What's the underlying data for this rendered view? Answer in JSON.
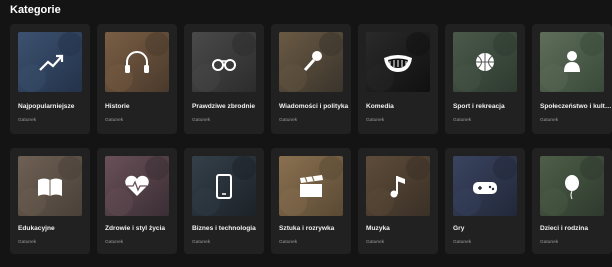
{
  "section": {
    "title": "Kategorie"
  },
  "cards": [
    {
      "title": "Najpopularniejsze",
      "subtitle": "Gatunek",
      "icon": "trending-icon",
      "bg": "#24324a",
      "accent": "#3c5270"
    },
    {
      "title": "Historie",
      "subtitle": "Gatunek",
      "icon": "headphones-icon",
      "bg": "#4a3a2c",
      "accent": "#7a5e44"
    },
    {
      "title": "Prawdziwe zbrodnie",
      "subtitle": "Gatunek",
      "icon": "handcuffs-icon",
      "bg": "#2c2c2c",
      "accent": "#4a4a4a"
    },
    {
      "title": "Wiadomości i polityka",
      "subtitle": "Gatunek",
      "icon": "microphone-icon",
      "bg": "#3a342c",
      "accent": "#6a5a44"
    },
    {
      "title": "Komedia",
      "subtitle": "Gatunek",
      "icon": "laughing-mouth-icon",
      "bg": "#101010",
      "accent": "#2a2a2a"
    },
    {
      "title": "Sport i rekreacja",
      "subtitle": "Gatunek",
      "icon": "basketball-icon",
      "bg": "#2e3a30",
      "accent": "#4a5a4a"
    },
    {
      "title": "Społeczeństwo i kultura",
      "subtitle": "Gatunek",
      "icon": "person-icon",
      "bg": "#3a4a3a",
      "accent": "#5e6e5a"
    },
    {
      "title": "Edukacyjne",
      "subtitle": "Gatunek",
      "icon": "open-book-icon",
      "bg": "#4a4038",
      "accent": "#6e6054"
    },
    {
      "title": "Zdrowie i styl życia",
      "subtitle": "Gatunek",
      "icon": "heartbeat-icon",
      "bg": "#3a2e34",
      "accent": "#6a5058"
    },
    {
      "title": "Biznes i technologia",
      "subtitle": "Gatunek",
      "icon": "smartphone-icon",
      "bg": "#1c2228",
      "accent": "#34404a"
    },
    {
      "title": "Sztuka i rozrywka",
      "subtitle": "Gatunek",
      "icon": "clapperboard-icon",
      "bg": "#5a4a34",
      "accent": "#8a7050"
    },
    {
      "title": "Muzyka",
      "subtitle": "Gatunek",
      "icon": "music-note-icon",
      "bg": "#3a3026",
      "accent": "#5e4c3a"
    },
    {
      "title": "Gry",
      "subtitle": "Gatunek",
      "icon": "gamepad-icon",
      "bg": "#22283a",
      "accent": "#3a4460"
    },
    {
      "title": "Dzieci i rodzina",
      "subtitle": "Gatunek",
      "icon": "balloon-icon",
      "bg": "#2e3a2e",
      "accent": "#4e5e48"
    }
  ]
}
